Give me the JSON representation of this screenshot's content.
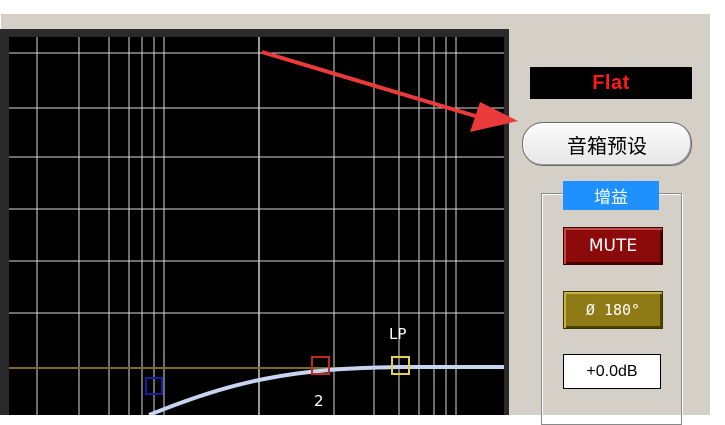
{
  "graph": {
    "nodes": [
      {
        "id": "node-hp",
        "label": "",
        "color": "#1a1aa8"
      },
      {
        "id": "node-2",
        "label": "2",
        "color": "#c0271e"
      },
      {
        "id": "node-lp",
        "label": "LP",
        "color": "#e6d24a"
      }
    ],
    "curve_color": "#c8d4f0",
    "grid_color": "#d8d8d8",
    "reference_line_color": "#7a6a28"
  },
  "side_panel": {
    "preset_display": "Flat",
    "preset_display_color": "#ff1a1a",
    "speaker_preset_button": "音箱预设",
    "gain_group_title": "增益",
    "mute_button": "MUTE",
    "phase_button": "Ø 180°",
    "gain_value": "+0.0dB"
  },
  "annotation": {
    "arrow_color": "#ea3a3a"
  }
}
